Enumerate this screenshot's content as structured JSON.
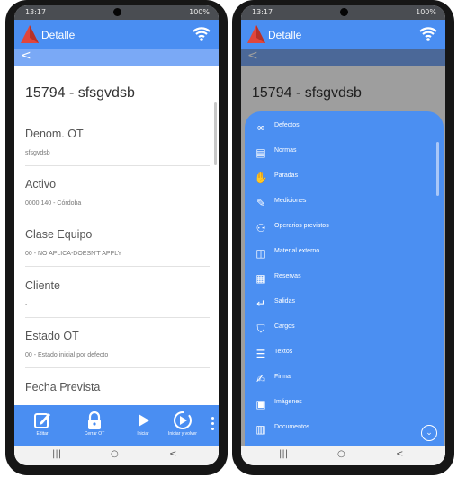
{
  "status": {
    "time": "13:17",
    "right": "100%"
  },
  "app": {
    "title": "Detalle",
    "back": "<"
  },
  "detail": {
    "header": "15794 - sfsgvdsb",
    "fields": [
      {
        "label": "Denom. OT",
        "value": "sfsgvdsb"
      },
      {
        "label": "Activo",
        "value": "0000.140 - Córdoba"
      },
      {
        "label": "Clase Equipo",
        "value": "00 - NO APLICA-DOESN'T APPLY"
      },
      {
        "label": "Cliente",
        "value": "-"
      },
      {
        "label": "Estado OT",
        "value": "00 - Estado inicial por defecto"
      },
      {
        "label": "Fecha Prevista",
        "value": ""
      }
    ]
  },
  "toolbar": {
    "buttons": [
      {
        "label": "Editar",
        "icon": "edit-icon"
      },
      {
        "label": "Cerrar OT",
        "icon": "lock-icon"
      },
      {
        "label": "Iniciar",
        "icon": "play-icon"
      },
      {
        "label": "Iniciar y volver",
        "icon": "play-circle-icon"
      }
    ]
  },
  "nav": {
    "recent": "|||",
    "home": "○",
    "back": "<"
  },
  "menu": {
    "items": [
      {
        "label": "Defectos",
        "icon": "glasses-icon",
        "glyph": "∞"
      },
      {
        "label": "Normas",
        "icon": "clipboard-icon",
        "glyph": "▤"
      },
      {
        "label": "Paradas",
        "icon": "hand-icon",
        "glyph": "✋"
      },
      {
        "label": "Mediciones",
        "icon": "ruler-icon",
        "glyph": "✎"
      },
      {
        "label": "Operarios previstos",
        "icon": "person-icon",
        "glyph": "⚇"
      },
      {
        "label": "Material externo",
        "icon": "book-icon",
        "glyph": "◫"
      },
      {
        "label": "Reservas",
        "icon": "inventory-icon",
        "glyph": "▦"
      },
      {
        "label": "Salidas",
        "icon": "exit-icon",
        "glyph": "↵"
      },
      {
        "label": "Cargos",
        "icon": "shield-icon",
        "glyph": "⛉"
      },
      {
        "label": "Textos",
        "icon": "text-icon",
        "glyph": "☰"
      },
      {
        "label": "Firma",
        "icon": "signature-icon",
        "glyph": "✍"
      },
      {
        "label": "Imágenes",
        "icon": "image-icon",
        "glyph": "▣"
      },
      {
        "label": "Documentos",
        "icon": "document-icon",
        "glyph": "▥"
      }
    ],
    "scroll_down": "⌄"
  },
  "colors": {
    "primary": "#4a8ef2",
    "secondary": "#7aa9f6",
    "logo": "#e0463c"
  }
}
